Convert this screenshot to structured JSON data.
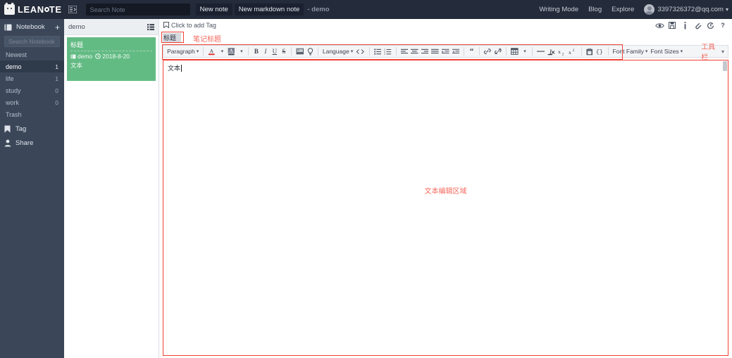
{
  "topbar": {
    "brand": "LEAN",
    "brand_tail": "TE",
    "collapse_icon": "list-collapse-icon",
    "search": {
      "placeholder": "Search Note",
      "value": "",
      "icon": "search-icon"
    },
    "new_note_label": "New note",
    "new_markdown_note_label": "New markdown note",
    "current_notebook_label": "- demo",
    "links": [
      {
        "label": "Writing Mode",
        "name": "writing-mode-link"
      },
      {
        "label": "Blog",
        "name": "blog-link"
      },
      {
        "label": "Explore",
        "name": "explore-link"
      }
    ],
    "user": {
      "email": "3397326372@qq.com",
      "caret": "▾",
      "avatar_icon": "avatar-icon"
    }
  },
  "sidebar": {
    "header": {
      "label": "Notebook",
      "icon": "notebook-icon",
      "add_label": "+"
    },
    "search": {
      "placeholder": "Search Notebook",
      "value": ""
    },
    "items": [
      {
        "label": "Newest",
        "count": "",
        "active": false,
        "name": "sidebar-item-newest"
      },
      {
        "label": "demo",
        "count": "1",
        "active": true,
        "name": "sidebar-item-demo"
      },
      {
        "label": "life",
        "count": "1",
        "active": false,
        "name": "sidebar-item-life"
      },
      {
        "label": "study",
        "count": "0",
        "active": false,
        "name": "sidebar-item-study"
      },
      {
        "label": "work",
        "count": "0",
        "active": false,
        "name": "sidebar-item-work"
      },
      {
        "label": "Trash",
        "count": "",
        "active": false,
        "name": "sidebar-item-trash"
      }
    ],
    "bottom_items": [
      {
        "label": "Tag",
        "icon": "tag-icon",
        "name": "sidebar-item-tag"
      },
      {
        "label": "Share",
        "icon": "share-user-icon",
        "name": "sidebar-item-share"
      }
    ]
  },
  "notelist": {
    "header_title": "demo",
    "layout_icon": "list-layout-icon",
    "notes": [
      {
        "title": "标题",
        "notebook": "demo",
        "notebook_icon": "notebook-small-icon",
        "date_icon": "clock-icon",
        "date": "2018-8-20",
        "excerpt": "文本",
        "selected": true
      }
    ]
  },
  "editor": {
    "tagbar": {
      "icon": "tag-add-icon",
      "label": "Click to add Tag"
    },
    "title_input": {
      "value": "标题",
      "placeholder": ""
    },
    "content": "文本",
    "note_actions": [
      {
        "name": "preview-eye-icon",
        "title": "Preview"
      },
      {
        "name": "save-disk-icon",
        "title": "Save"
      },
      {
        "name": "info-icon",
        "title": "Info"
      },
      {
        "name": "attachment-icon",
        "title": "Attachment"
      },
      {
        "name": "history-icon",
        "title": "History"
      },
      {
        "name": "help-icon",
        "title": "Help",
        "label": "?"
      }
    ],
    "toolbar": {
      "groups": [
        [
          {
            "label": "Paragraph",
            "type": "text",
            "caret": true,
            "name": "paragraph-dropdown"
          }
        ],
        [
          {
            "label": "",
            "type": "icon",
            "icon": "font-color-icon",
            "name": "font-color-button"
          },
          {
            "label": "",
            "type": "caret",
            "name": "font-color-dropdown"
          },
          {
            "label": "",
            "type": "icon",
            "icon": "highlight-color-icon",
            "name": "highlight-color-button"
          },
          {
            "label": "",
            "type": "caret",
            "name": "highlight-color-dropdown"
          }
        ],
        [
          {
            "label": "B",
            "type": "bold",
            "name": "bold-button"
          },
          {
            "label": "I",
            "type": "italic",
            "name": "italic-button"
          },
          {
            "label": "U",
            "type": "underline",
            "name": "underline-button"
          },
          {
            "label": "S",
            "type": "strike",
            "name": "strikethrough-button"
          }
        ],
        [
          {
            "label": "",
            "type": "icon",
            "icon": "image-icon",
            "name": "insert-image-button"
          },
          {
            "label": "",
            "type": "icon",
            "icon": "lightbulb-icon",
            "name": "insert-hint-button"
          }
        ],
        [
          {
            "label": "Language",
            "type": "text",
            "caret": true,
            "name": "language-dropdown"
          }
        ],
        [
          {
            "label": "",
            "type": "icon",
            "icon": "code-brackets-icon",
            "name": "insert-code-button"
          }
        ],
        [
          {
            "label": "",
            "type": "icon",
            "icon": "unordered-list-icon",
            "name": "unordered-list-button"
          },
          {
            "label": "",
            "type": "icon",
            "icon": "ordered-list-icon",
            "name": "ordered-list-button"
          }
        ],
        [
          {
            "label": "",
            "type": "icon",
            "icon": "align-left-icon",
            "name": "align-left-button"
          },
          {
            "label": "",
            "type": "icon",
            "icon": "align-center-icon",
            "name": "align-center-button"
          },
          {
            "label": "",
            "type": "icon",
            "icon": "align-right-icon",
            "name": "align-right-button"
          },
          {
            "label": "",
            "type": "icon",
            "icon": "align-justify-icon",
            "name": "align-justify-button"
          },
          {
            "label": "",
            "type": "icon",
            "icon": "indent-icon",
            "name": "indent-button"
          },
          {
            "label": "",
            "type": "icon",
            "icon": "outdent-icon",
            "name": "outdent-button"
          }
        ],
        [
          {
            "label": "",
            "type": "icon",
            "icon": "blockquote-icon",
            "name": "blockquote-button"
          }
        ],
        [
          {
            "label": "",
            "type": "icon",
            "icon": "link-icon",
            "name": "insert-link-button"
          },
          {
            "label": "",
            "type": "icon",
            "icon": "unlink-icon",
            "name": "unlink-button"
          }
        ],
        [
          {
            "label": "",
            "type": "icon",
            "icon": "table-icon",
            "name": "insert-table-button"
          },
          {
            "label": "",
            "type": "caret",
            "name": "table-dropdown"
          }
        ],
        [
          {
            "label": "",
            "type": "icon",
            "icon": "horizontal-rule-icon",
            "name": "horizontal-rule-button"
          }
        ],
        [
          {
            "label": "",
            "type": "icon",
            "icon": "clear-format-icon",
            "name": "clear-format-button"
          }
        ],
        [
          {
            "label": "",
            "type": "icon",
            "icon": "subscript-icon",
            "name": "subscript-button"
          },
          {
            "label": "",
            "type": "icon",
            "icon": "superscript-icon",
            "name": "superscript-button"
          }
        ],
        [
          {
            "label": "",
            "type": "icon",
            "icon": "paste-icon",
            "name": "paste-button"
          }
        ],
        [
          {
            "label": "",
            "type": "icon",
            "icon": "code-block-icon",
            "name": "code-block-button"
          }
        ],
        [
          {
            "label": "Font Family",
            "type": "text",
            "caret": true,
            "name": "font-family-dropdown"
          }
        ],
        [
          {
            "label": "Font Sizes",
            "type": "text",
            "caret": true,
            "name": "font-sizes-dropdown"
          }
        ]
      ],
      "expand_caret": "▾"
    }
  },
  "annotations": {
    "title_label": "笔记标题",
    "toolbar_label": "工具栏",
    "editor_label": "文本编辑区域",
    "color": "#ef4136",
    "text_color": "#f4695e"
  },
  "colors": {
    "topbar_bg": "#242b3a",
    "sidebar_bg": "#3b4759",
    "sidebar_active_bg": "#2f3a4a",
    "note_selected_bg": "#63bb84",
    "toolbar_bg": "#f4f5f7",
    "annotation_red": "#ef4136"
  }
}
